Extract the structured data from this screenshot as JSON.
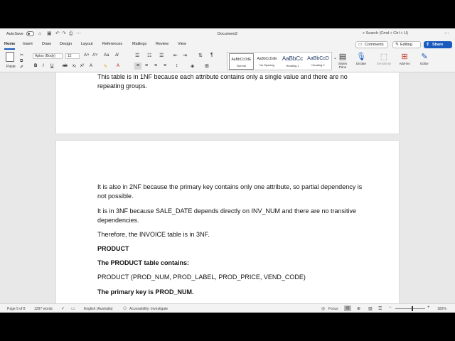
{
  "titlebar": {
    "autosave_label": "AutoSave",
    "document_title": "Document2",
    "search_placeholder": "Search (Cmd + Ctrl + U)"
  },
  "tabs": [
    "Home",
    "Insert",
    "Draw",
    "Design",
    "Layout",
    "References",
    "Mailings",
    "Review",
    "View"
  ],
  "actions": {
    "comments": "Comments",
    "editing": "Editing",
    "share": "Share"
  },
  "ribbon": {
    "paste": "Paste",
    "font_name": "Aptos (Body)",
    "font_size": "12",
    "styles": [
      {
        "sample": "AaBbCcDdE",
        "name": "Normal"
      },
      {
        "sample": "AaBbCcDdE",
        "name": "No Spacing"
      },
      {
        "sample": "AaBbCc",
        "name": "Heading 1"
      },
      {
        "sample": "AaBbCcD",
        "name": "Heading 2"
      }
    ],
    "styles_pane": "Styles Pane",
    "dictate": "Dictate",
    "sensitivity": "Sensitivity",
    "addins": "Add-ins",
    "editor": "Editor"
  },
  "document": {
    "page1_text": "This table is in 1NF because each attribute contains only a single value and there are no repeating groups.",
    "page2_paragraphs": [
      {
        "text": "It is also in 2NF because the primary key contains only one attribute, so partial dependency is not possible.",
        "bold": false
      },
      {
        "text": "It is in 3NF because SALE_DATE depends directly on INV_NUM and there are no transitive dependencies.",
        "bold": false
      },
      {
        "text": "Therefore, the INVOICE table is in 3NF.",
        "bold": false
      },
      {
        "text": "PRODUCT",
        "bold": true
      },
      {
        "text": "The PRODUCT table contains:",
        "bold": true
      },
      {
        "text": "PRODUCT (PROD_NUM, PROD_LABEL, PROD_PRICE, VEND_CODE)",
        "bold": false
      },
      {
        "text": "The primary key is PROD_NUM.",
        "bold": true
      }
    ]
  },
  "status": {
    "page": "Page 5 of 8",
    "words": "1297 words",
    "language": "English (Australia)",
    "accessibility": "Accessibility: Investigate",
    "focus": "Focus",
    "zoom": "183%"
  },
  "colors": {
    "accent": "#185abd"
  }
}
